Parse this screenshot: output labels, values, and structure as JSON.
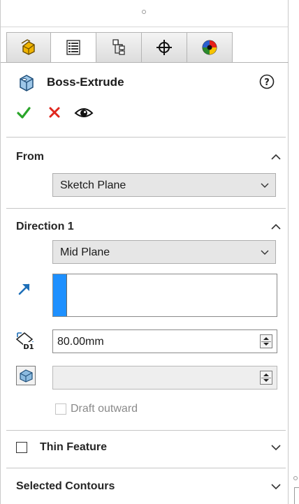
{
  "feature": {
    "title": "Boss-Extrude",
    "icon": "boss-extrude-icon",
    "help_icon": "help-icon"
  },
  "tabs": [
    {
      "icon": "feature-manager-icon"
    },
    {
      "icon": "property-manager-icon"
    },
    {
      "icon": "configuration-manager-icon"
    },
    {
      "icon": "dimxpert-manager-icon"
    },
    {
      "icon": "display-manager-icon"
    }
  ],
  "actions": [
    {
      "icon": "ok-check-icon",
      "color": "#2aa52a"
    },
    {
      "icon": "cancel-x-icon",
      "color": "#e0261d"
    },
    {
      "icon": "preview-eye-icon"
    }
  ],
  "from": {
    "title": "From",
    "value": "Sketch Plane"
  },
  "direction1": {
    "title": "Direction 1",
    "end_condition": "Mid Plane",
    "depth": "80.00mm",
    "depth_icon_label": "D1",
    "draft_value": "",
    "draft_outward_label": "Draft outward"
  },
  "thin_feature": {
    "label": "Thin Feature"
  },
  "selected_contours": {
    "label": "Selected Contours"
  },
  "colors": {
    "selection_bar": "#1e90ff",
    "accent_arrow": "#1d6fb8"
  }
}
